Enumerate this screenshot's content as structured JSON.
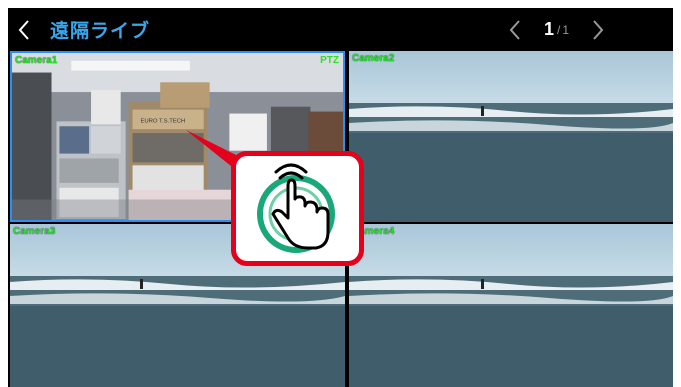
{
  "header": {
    "title": "遠隔ライブ",
    "page_current": "1",
    "page_separator": "/",
    "page_total": "1"
  },
  "cameras": [
    {
      "label": "Camera1",
      "ptz": "PTZ"
    },
    {
      "label": "Camera2"
    },
    {
      "label": "Camera3"
    },
    {
      "label": "Camera4"
    }
  ],
  "scene": {
    "box_text": "EURO T.S.TECH"
  },
  "colors": {
    "title_blue": "#39a7ec",
    "camera_label_green": "#29e02b",
    "selected_border": "#2f8ff0",
    "callout_red": "#e5001b",
    "tap_green": "#1aa77a"
  },
  "icons": {
    "back": "chevron-left-icon",
    "prev": "chevron-left-icon",
    "next": "chevron-right-icon",
    "tap": "hand-tap-icon"
  }
}
